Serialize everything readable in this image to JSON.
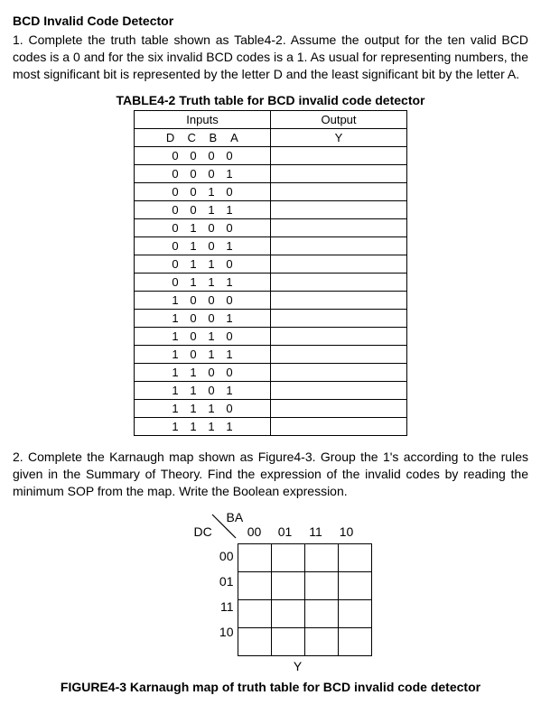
{
  "title": "BCD Invalid Code Detector",
  "para1": "1. Complete the truth table shown as Table4-2. Assume the output for the ten valid BCD codes is a 0 and for the six invalid BCD codes is a 1. As usual for representing numbers, the most significant bit is represented by the letter D and the least significant bit by the letter A.",
  "table": {
    "caption": "TABLE4-2 Truth table for BCD invalid code detector",
    "header_inputs": "Inputs",
    "header_output": "Output",
    "col_labels": [
      "D",
      "C",
      "B",
      "A"
    ],
    "output_label": "Y",
    "rows": [
      {
        "d": "0",
        "c": "0",
        "b": "0",
        "a": "0",
        "y": ""
      },
      {
        "d": "0",
        "c": "0",
        "b": "0",
        "a": "1",
        "y": ""
      },
      {
        "d": "0",
        "c": "0",
        "b": "1",
        "a": "0",
        "y": ""
      },
      {
        "d": "0",
        "c": "0",
        "b": "1",
        "a": "1",
        "y": ""
      },
      {
        "d": "0",
        "c": "1",
        "b": "0",
        "a": "0",
        "y": ""
      },
      {
        "d": "0",
        "c": "1",
        "b": "0",
        "a": "1",
        "y": ""
      },
      {
        "d": "0",
        "c": "1",
        "b": "1",
        "a": "0",
        "y": ""
      },
      {
        "d": "0",
        "c": "1",
        "b": "1",
        "a": "1",
        "y": ""
      },
      {
        "d": "1",
        "c": "0",
        "b": "0",
        "a": "0",
        "y": ""
      },
      {
        "d": "1",
        "c": "0",
        "b": "0",
        "a": "1",
        "y": ""
      },
      {
        "d": "1",
        "c": "0",
        "b": "1",
        "a": "0",
        "y": ""
      },
      {
        "d": "1",
        "c": "0",
        "b": "1",
        "a": "1",
        "y": ""
      },
      {
        "d": "1",
        "c": "1",
        "b": "0",
        "a": "0",
        "y": ""
      },
      {
        "d": "1",
        "c": "1",
        "b": "0",
        "a": "1",
        "y": ""
      },
      {
        "d": "1",
        "c": "1",
        "b": "1",
        "a": "0",
        "y": ""
      },
      {
        "d": "1",
        "c": "1",
        "b": "1",
        "a": "1",
        "y": ""
      }
    ]
  },
  "para2": "2. Complete the Karnaugh map shown as Figure4-3. Group the 1's according to the rules given in the Summary of Theory. Find the expression of the invalid codes by reading the minimum SOP from the map. Write the Boolean expression.",
  "kmap": {
    "cols_var": "BA",
    "rows_var": "DC",
    "col_labels": [
      "00",
      "01",
      "11",
      "10"
    ],
    "row_labels": [
      "00",
      "01",
      "11",
      "10"
    ],
    "output_label": "Y",
    "caption": "FIGURE4-3 Karnaugh map of truth table for BCD invalid code detector"
  }
}
